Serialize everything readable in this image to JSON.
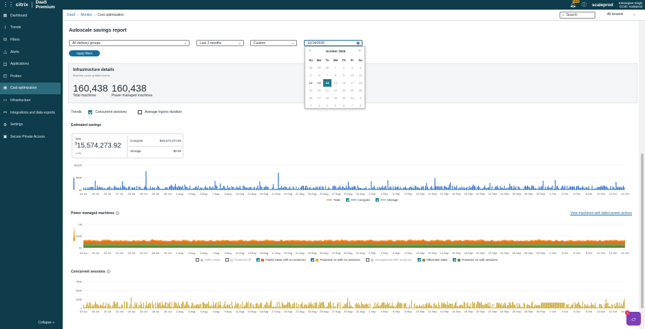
{
  "app": {
    "vendor": "citrix",
    "product": "DaaS Premium",
    "customer": "scaleprod",
    "user_name": "Simranjeet Singh",
    "user_org": "CCID: scaleprod",
    "notification_badge": "NEW",
    "grid_icon": "app-grid-icon",
    "bell_icon": "bell-icon",
    "help_icon": "question-circle-icon"
  },
  "sidebar": {
    "items": [
      {
        "label": "Dashboard",
        "icon": "dashboard-icon",
        "glyph": "▦"
      },
      {
        "label": "Trends",
        "icon": "trends-icon",
        "glyph": "⌇"
      },
      {
        "label": "Filters",
        "icon": "filter-icon",
        "glyph": "⊟"
      },
      {
        "label": "Alerts",
        "icon": "bell-icon",
        "glyph": "△"
      },
      {
        "label": "Applications",
        "icon": "applications-icon",
        "glyph": "◫"
      },
      {
        "label": "Probes",
        "icon": "probe-icon",
        "glyph": "◰"
      },
      {
        "label": "Cost optimization",
        "icon": "cost-icon",
        "glyph": "⛃"
      },
      {
        "label": "Infrastructure",
        "icon": "infrastructure-icon",
        "glyph": "▭"
      },
      {
        "label": "Integrations and data exports",
        "icon": "integrations-icon",
        "glyph": "⚯"
      },
      {
        "label": "Settings",
        "icon": "gear-icon",
        "glyph": "⚙"
      },
      {
        "label": "Secure Private Access",
        "icon": "lock-icon",
        "glyph": "▣"
      }
    ],
    "active_index": 6,
    "collapse_label": "Collapse"
  },
  "breadcrumb": {
    "items": [
      "DaaS",
      "Monitor",
      "Cost optimization"
    ]
  },
  "search": {
    "placeholder": "Search"
  },
  "tenants": {
    "label": "All tenants"
  },
  "page": {
    "title": "Autoscale savings report"
  },
  "filters": {
    "delivery_group": "All delivery groups",
    "period": "Last 3 months",
    "range": "Custom",
    "date": "10/14/2025",
    "apply": "Apply filters"
  },
  "calendar": {
    "month": "October 2025",
    "weekdays": [
      "Su",
      "Mo",
      "Tu",
      "We",
      "Th",
      "Fr",
      "Sa"
    ],
    "weeks": [
      [
        {
          "d": "28",
          "m": 0
        },
        {
          "d": "29",
          "m": 0
        },
        {
          "d": "30",
          "m": 0
        },
        {
          "d": "1",
          "m": 0
        },
        {
          "d": "2",
          "m": 0
        },
        {
          "d": "3",
          "m": 0
        },
        {
          "d": "4",
          "m": 0
        }
      ],
      [
        {
          "d": "5",
          "m": 0
        },
        {
          "d": "6",
          "m": 0
        },
        {
          "d": "7",
          "m": 0
        },
        {
          "d": "8",
          "m": 0
        },
        {
          "d": "9",
          "m": 0
        },
        {
          "d": "10",
          "m": 0
        },
        {
          "d": "11",
          "m": 0
        }
      ],
      [
        {
          "d": "12",
          "m": 1
        },
        {
          "d": "13",
          "m": 1
        },
        {
          "d": "14",
          "m": 2
        },
        {
          "d": "15",
          "m": 0
        },
        {
          "d": "16",
          "m": 0
        },
        {
          "d": "17",
          "m": 0
        },
        {
          "d": "18",
          "m": 0
        }
      ],
      [
        {
          "d": "19",
          "m": 0
        },
        {
          "d": "20",
          "m": 0
        },
        {
          "d": "21",
          "m": 0
        },
        {
          "d": "22",
          "m": 0
        },
        {
          "d": "23",
          "m": 0
        },
        {
          "d": "24",
          "m": 0
        },
        {
          "d": "25",
          "m": 0
        }
      ],
      [
        {
          "d": "26",
          "m": 0
        },
        {
          "d": "27",
          "m": 0
        },
        {
          "d": "28",
          "m": 0
        },
        {
          "d": "29",
          "m": 0
        },
        {
          "d": "30",
          "m": 0
        },
        {
          "d": "31",
          "m": 0
        },
        {
          "d": "1",
          "m": 0
        }
      ],
      [
        {
          "d": "2",
          "m": 0
        },
        {
          "d": "3",
          "m": 0
        },
        {
          "d": "4",
          "m": 0
        },
        {
          "d": "5",
          "m": 0
        },
        {
          "d": "6",
          "m": 0
        },
        {
          "d": "7",
          "m": 0
        },
        {
          "d": "8",
          "m": 0
        }
      ]
    ]
  },
  "infrastructure": {
    "title": "Infrastructure details",
    "subtitle": "Machine count updated hourly",
    "total": "160,438",
    "total_label": "Total machines",
    "power": "160,438",
    "power_label": "Power managed machines"
  },
  "trends": {
    "label": "Trends",
    "opt1": "Concurrent sessions",
    "opt2": "Average logons duration"
  },
  "estimated": {
    "title": "Estimated savings",
    "total_label": "Total",
    "total_currency": "$",
    "total_value": "15,574,273.92",
    "percent": "1.0%",
    "compute_label": "Compute",
    "compute_value": "$15,574,273.92",
    "storage_label": "Storage",
    "storage_value": "$0.00"
  },
  "power_section": {
    "title": "Power managed machines",
    "view_link": "View machines with failed power actions"
  },
  "concurrent_section": {
    "title": "Concurrent sessions"
  },
  "chart_data": [
    {
      "type": "bar",
      "title": "Estimated savings",
      "yticks": [
        "$100K",
        "$50K",
        "$0"
      ],
      "ylim": [
        0,
        100000
      ],
      "x_tick_labels": [
        "16 Jul",
        "18 Jul",
        "20 Jul",
        "22 Jul",
        "24 Jul",
        "26 Jul",
        "28 Jul",
        "30 Jul",
        "1 Aug",
        "3 Aug",
        "5 Aug",
        "7 Aug",
        "9 Aug",
        "11 Aug",
        "13 Aug",
        "15 Aug",
        "17 Aug",
        "19 Aug",
        "21 Aug",
        "23 Aug",
        "25 Aug",
        "27 Aug",
        "29 Aug",
        "31 Aug",
        "2 Sep",
        "4 Sep",
        "6 Sep",
        "8 Sep",
        "10 Sep",
        "12 Sep",
        "14 Sep",
        "16 Sep",
        "18 Sep",
        "20 Sep",
        "22 Sep",
        "24 Sep",
        "26 Sep",
        "28 Sep",
        "30 Sep",
        "2 Oct",
        "4 Oct",
        "6 Oct",
        "8 Oct",
        "10 Oct",
        "12 Oct",
        "14 Oct"
      ],
      "legend": [
        {
          "name": "Total",
          "color": "#a5722a"
        },
        {
          "name": "Compute",
          "color": "#2e6fd0"
        },
        {
          "name": "Storage",
          "color": "#2aa0a0"
        }
      ],
      "series_color": "#2e6fd0",
      "typical_value": 14000,
      "spikes": [
        {
          "x": "26 Jul",
          "value": 75000
        },
        {
          "x": "17 Aug",
          "value": 70000
        },
        {
          "x": "10 Aug",
          "value": 50000
        },
        {
          "x": "23 Sep",
          "value": 40000
        },
        {
          "x": "12 Sep",
          "value": 48000
        },
        {
          "x": "2 Oct",
          "value": 40000
        }
      ]
    },
    {
      "type": "area",
      "title": "Power managed machines",
      "yticks": [
        "1M",
        "100K",
        "1K"
      ],
      "log_scale": true,
      "x_tick_labels": [
        "16 Jul",
        "18 Jul",
        "20 Jul",
        "22 Jul",
        "24 Jul",
        "26 Jul",
        "28 Jul",
        "30 Jul",
        "1 Aug",
        "3 Aug",
        "5 Aug",
        "7 Aug",
        "9 Aug",
        "11 Aug",
        "13 Aug",
        "15 Aug",
        "17 Aug",
        "19 Aug",
        "21 Aug",
        "23 Aug",
        "25 Aug",
        "27 Aug",
        "29 Aug",
        "31 Aug",
        "2 Sep",
        "4 Sep",
        "6 Sep",
        "8 Sep",
        "10 Sep",
        "12 Sep",
        "14 Sep",
        "16 Sep",
        "18 Sep",
        "20 Sep",
        "22 Sep",
        "24 Sep",
        "26 Sep",
        "28 Sep",
        "30 Sep",
        "2 Oct",
        "4 Oct",
        "6 Oct",
        "8 Oct",
        "10 Oct",
        "12 Oct",
        "14 Oct"
      ],
      "legend": [
        {
          "name": "Other state",
          "color": "#c8c8c8",
          "checked": false
        },
        {
          "name": "Powered off",
          "color": "#d8d8d8",
          "checked": false
        },
        {
          "name": "Failed State with no sessions",
          "color": "#e86d24",
          "checked": true
        },
        {
          "name": "Powered on with no sessions",
          "color": "#f2a430",
          "checked": true
        },
        {
          "name": "Unregistered with sessions",
          "color": "#d0d0d0",
          "checked": false
        },
        {
          "name": "Hibernate state",
          "color": "#7a9e4a",
          "checked": true
        },
        {
          "name": "Powered on with sessions",
          "color": "#5b8a3a",
          "checked": true
        }
      ],
      "spikes": [
        {
          "x": "22 Aug",
          "value": 100000
        },
        {
          "x": "31 Jul",
          "value": 80000
        }
      ]
    },
    {
      "type": "bar",
      "title": "Concurrent sessions",
      "yticks": [
        "750K",
        "500K",
        "250K",
        "0"
      ],
      "ylim": [
        0,
        750000
      ],
      "x_tick_labels": [
        "16 Jul",
        "18 Jul",
        "20 Jul",
        "22 Jul",
        "24 Jul",
        "26 Jul",
        "28 Jul",
        "30 Jul",
        "1 Aug",
        "3 Aug",
        "5 Aug",
        "7 Aug",
        "9 Aug",
        "11 Aug",
        "13 Aug",
        "15 Aug",
        "17 Aug",
        "19 Aug",
        "21 Aug",
        "23 Aug",
        "25 Aug",
        "27 Aug",
        "29 Aug",
        "31 Aug",
        "2 Sep",
        "4 Sep",
        "6 Sep",
        "8 Sep",
        "10 Sep",
        "12 Sep",
        "14 Sep",
        "16 Sep",
        "18 Sep",
        "20 Sep",
        "22 Sep",
        "24 Sep",
        "26 Sep",
        "28 Sep",
        "30 Sep",
        "2 Oct",
        "4 Oct",
        "6 Oct",
        "8 Oct",
        "10 Oct",
        "12 Oct",
        "14 Oct"
      ],
      "series_color": "#c8a227",
      "typical_value": 120000,
      "plateau": {
        "from": "30 Sep",
        "to": "4 Oct",
        "value": 160000
      }
    }
  ]
}
